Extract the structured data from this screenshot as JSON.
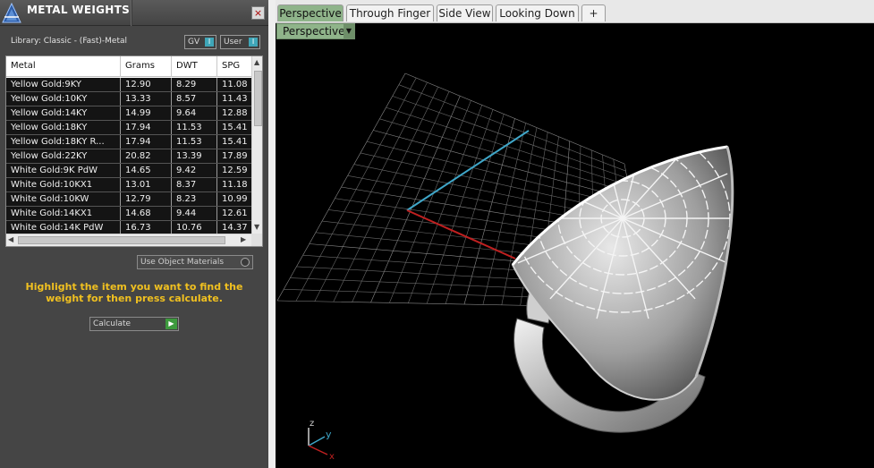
{
  "panel": {
    "title": "METAL WEIGHTS",
    "close_label": "×",
    "library_label": "Library: Classic - (Fast)-Metal",
    "toggles": [
      {
        "label": "GV",
        "indicator": "I"
      },
      {
        "label": "User",
        "indicator": "I"
      }
    ],
    "table": {
      "columns": [
        "Metal",
        "Grams",
        "DWT",
        "SPG"
      ],
      "rows": [
        [
          "Yellow Gold:9KY",
          "12.90",
          "8.29",
          "11.08"
        ],
        [
          "Yellow Gold:10KY",
          "13.33",
          "8.57",
          "11.43"
        ],
        [
          "Yellow Gold:14KY",
          "14.99",
          "9.64",
          "12.88"
        ],
        [
          "Yellow Gold:18KY",
          "17.94",
          "11.53",
          "15.41"
        ],
        [
          "Yellow Gold:18KY R...",
          "17.94",
          "11.53",
          "15.41"
        ],
        [
          "Yellow Gold:22KY",
          "20.82",
          "13.39",
          "17.89"
        ],
        [
          "White Gold:9K PdW",
          "14.65",
          "9.42",
          "12.59"
        ],
        [
          "White Gold:10KX1",
          "13.01",
          "8.37",
          "11.18"
        ],
        [
          "White Gold:10KW",
          "12.79",
          "8.23",
          "10.99"
        ],
        [
          "White Gold:14KX1",
          "14.68",
          "9.44",
          "12.61"
        ],
        [
          "White Gold:14K PdW",
          "16.73",
          "10.76",
          "14.37"
        ]
      ]
    },
    "use_object_materials": "Use Object Materials",
    "hint": "Highlight the item you want to find the weight for then press calculate.",
    "calculate_label": "Calculate"
  },
  "viewport": {
    "tabs": [
      "Perspective",
      "Through Finger",
      "Side View",
      "Looking Down",
      "+"
    ],
    "active_tab": 0,
    "view_menu_label": "Perspective",
    "axis_labels": {
      "z": "z",
      "y": "y",
      "x": "x"
    }
  },
  "colors": {
    "panel_bg": "#454545",
    "accent_green": "#8fb48a",
    "hint_yellow": "#f0c020",
    "axis_x": "#c02020",
    "axis_y": "#3fa6c8",
    "axis_z": "#d0d0d0"
  }
}
